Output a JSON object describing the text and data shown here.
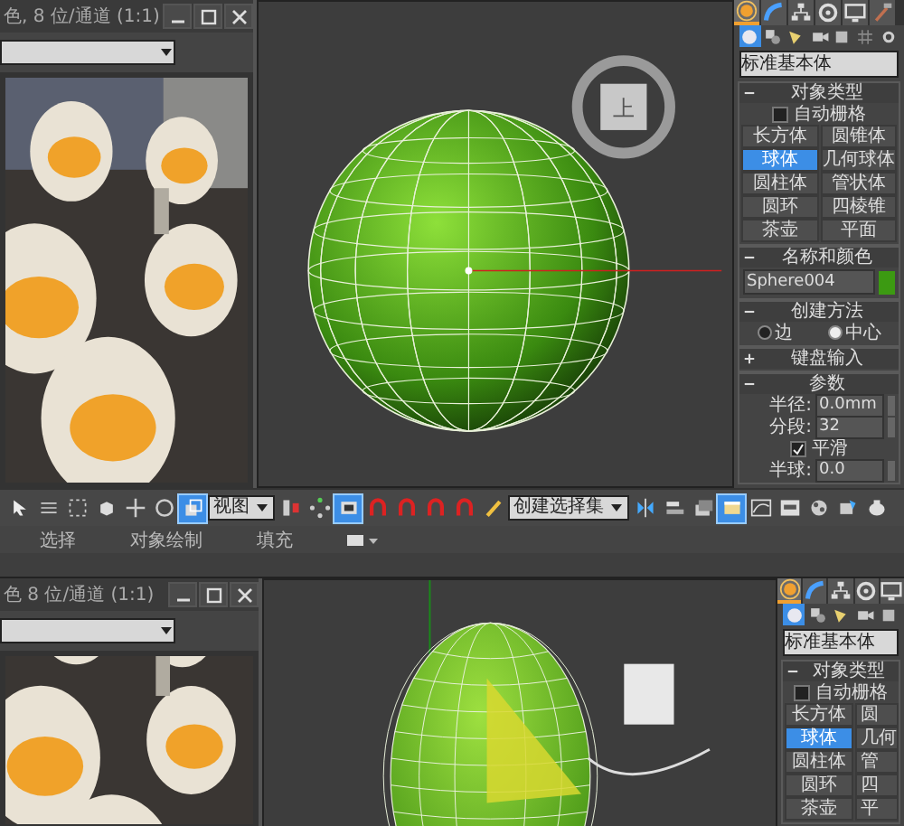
{
  "top": {
    "render_window": {
      "title": "色, 8 位/通道 (1:1)"
    },
    "viewport": {
      "viewcube_label": "上"
    },
    "command_panel": {
      "tabs": [
        {
          "kind": "create",
          "selected": true
        },
        {
          "kind": "modify",
          "selected": false
        },
        {
          "kind": "hierarchy",
          "selected": false
        },
        {
          "kind": "motion",
          "selected": false
        },
        {
          "kind": "display",
          "selected": false
        },
        {
          "kind": "utilities",
          "selected": false
        }
      ],
      "categories": [
        {
          "kind": "geometry",
          "selected": true
        },
        {
          "kind": "shapes",
          "selected": false
        },
        {
          "kind": "lights",
          "selected": false
        },
        {
          "kind": "cameras",
          "selected": false
        },
        {
          "kind": "helpers",
          "selected": false
        },
        {
          "kind": "spacewarps",
          "selected": false
        },
        {
          "kind": "systems",
          "selected": false
        }
      ],
      "dropdown": "标准基本体",
      "object_type": {
        "title": "对象类型",
        "expanded": true,
        "auto_grid": {
          "label": "自动栅格",
          "checked": false
        },
        "buttons": [
          {
            "label": "长方体",
            "selected": false
          },
          {
            "label": "圆锥体",
            "selected": false
          },
          {
            "label": "球体",
            "selected": true
          },
          {
            "label": "几何球体",
            "selected": false
          },
          {
            "label": "圆柱体",
            "selected": false
          },
          {
            "label": "管状体",
            "selected": false
          },
          {
            "label": "圆环",
            "selected": false
          },
          {
            "label": "四棱锥",
            "selected": false
          },
          {
            "label": "茶壶",
            "selected": false
          },
          {
            "label": "平面",
            "selected": false
          }
        ]
      },
      "name_color": {
        "title": "名称和颜色",
        "expanded": true,
        "name": "Sphere004",
        "color": "#3c9a12"
      },
      "creation_method": {
        "title": "创建方法",
        "expanded": true,
        "options": [
          {
            "label": "边",
            "selected": false
          },
          {
            "label": "中心",
            "selected": true
          }
        ]
      },
      "keyboard_entry": {
        "title": "键盘输入",
        "expanded": false
      },
      "parameters": {
        "title": "参数",
        "expanded": true,
        "fields": [
          {
            "label": "半径:",
            "value": "0.0mm"
          },
          {
            "label": "分段:",
            "value": "32"
          }
        ],
        "smooth": {
          "label": "平滑",
          "checked": true
        },
        "hemisphere": {
          "label": "半球:",
          "value": "0.0"
        }
      }
    }
  },
  "toolbar": {
    "items": [
      {
        "kind": "select",
        "active": false
      },
      {
        "kind": "select-name",
        "active": false
      },
      {
        "kind": "region",
        "active": false
      },
      {
        "kind": "cube",
        "active": false
      },
      {
        "kind": "move",
        "active": false
      },
      {
        "kind": "rotate",
        "active": false
      },
      {
        "kind": "crossing",
        "active": true
      },
      {
        "kind": "dropdown",
        "value": "视图"
      },
      {
        "kind": "pivot",
        "active": false
      },
      {
        "kind": "points",
        "active": false
      },
      {
        "kind": "manipulate",
        "active": true
      },
      {
        "kind": "magnet",
        "active": false
      },
      {
        "kind": "magnet",
        "active": false
      },
      {
        "kind": "magnet",
        "active": false
      },
      {
        "kind": "magnet",
        "active": false
      },
      {
        "kind": "pencil",
        "active": false
      },
      {
        "kind": "dropdown",
        "value": "创建选择集"
      },
      {
        "kind": "mirror",
        "active": false
      },
      {
        "kind": "align",
        "active": false
      },
      {
        "kind": "layers",
        "active": false
      },
      {
        "kind": "explorer",
        "active": true
      },
      {
        "kind": "curve",
        "active": false
      },
      {
        "kind": "schematic",
        "active": false
      },
      {
        "kind": "material",
        "active": false
      },
      {
        "kind": "render-setup",
        "active": false
      },
      {
        "kind": "teapot",
        "active": false
      }
    ]
  },
  "ribbon": {
    "tabs": [
      {
        "label": "选择"
      },
      {
        "label": "对象绘制"
      },
      {
        "label": "填充"
      }
    ]
  },
  "bottom": {
    "render_window": {
      "title": "色 8 位/通道 (1:1)"
    },
    "command_panel": {
      "tabs": [
        {
          "kind": "create",
          "selected": true
        },
        {
          "kind": "modify",
          "selected": false
        },
        {
          "kind": "hierarchy",
          "selected": false
        },
        {
          "kind": "motion",
          "selected": false
        },
        {
          "kind": "display",
          "selected": false
        }
      ],
      "categories": [
        {
          "kind": "geometry",
          "selected": true
        },
        {
          "kind": "shapes",
          "selected": false
        },
        {
          "kind": "lights",
          "selected": false
        },
        {
          "kind": "cameras",
          "selected": false
        },
        {
          "kind": "helpers",
          "selected": false
        }
      ],
      "dropdown": "标准基本体",
      "object_type": {
        "title": "对象类型",
        "expanded": true,
        "auto_grid": {
          "label": "自动栅格",
          "checked": false
        },
        "buttons": [
          {
            "label": "长方体",
            "selected": false
          },
          {
            "label": "圆",
            "selected": false
          },
          {
            "label": "球体",
            "selected": true
          },
          {
            "label": "几何",
            "selected": false
          },
          {
            "label": "圆柱体",
            "selected": false
          },
          {
            "label": "管",
            "selected": false
          },
          {
            "label": "圆环",
            "selected": false
          },
          {
            "label": "四",
            "selected": false
          },
          {
            "label": "茶壶",
            "selected": false
          },
          {
            "label": "平",
            "selected": false
          }
        ]
      }
    }
  }
}
